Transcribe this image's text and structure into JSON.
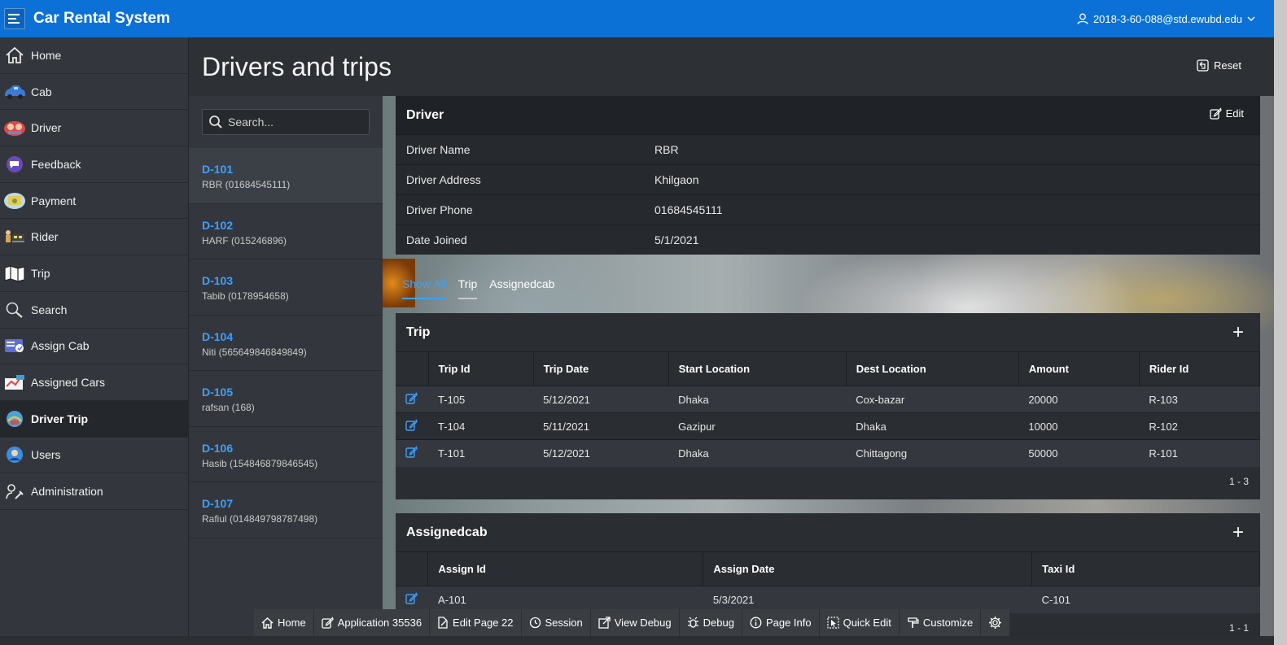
{
  "header": {
    "app_title": "Car Rental System",
    "user": "2018-3-60-088@std.ewubd.edu"
  },
  "sidebar": {
    "items": [
      {
        "label": "Home",
        "icon": "home-icon"
      },
      {
        "label": "Cab",
        "icon": "cab-icon"
      },
      {
        "label": "Driver",
        "icon": "driver-icon"
      },
      {
        "label": "Feedback",
        "icon": "feedback-icon"
      },
      {
        "label": "Payment",
        "icon": "payment-icon"
      },
      {
        "label": "Rider",
        "icon": "rider-icon"
      },
      {
        "label": "Trip",
        "icon": "trip-map-icon"
      },
      {
        "label": "Search",
        "icon": "search-icon"
      },
      {
        "label": "Assign Cab",
        "icon": "assign-cab-icon"
      },
      {
        "label": "Assigned Cars",
        "icon": "assigned-cars-icon"
      },
      {
        "label": "Driver Trip",
        "icon": "driver-trip-icon"
      },
      {
        "label": "Users",
        "icon": "users-icon"
      },
      {
        "label": "Administration",
        "icon": "administration-icon"
      }
    ],
    "active": "Driver Trip"
  },
  "page": {
    "title": "Drivers and trips",
    "reset_label": "Reset"
  },
  "search": {
    "placeholder": "Search..."
  },
  "drivers": [
    {
      "code": "D-101",
      "sub": "RBR (01684545111)"
    },
    {
      "code": "D-102",
      "sub": "HARF (015246896)"
    },
    {
      "code": "D-103",
      "sub": "Tabib (0178954658)"
    },
    {
      "code": "D-104",
      "sub": "Niti (565649846849849)"
    },
    {
      "code": "D-105",
      "sub": "rafsan (168)"
    },
    {
      "code": "D-106",
      "sub": "Hasib (154846879846545)"
    },
    {
      "code": "D-107",
      "sub": "Rafiul (014849798787498)"
    }
  ],
  "driver_card": {
    "title": "Driver",
    "edit_label": "Edit",
    "fields": [
      {
        "label": "Driver Name",
        "value": "RBR"
      },
      {
        "label": "Driver Address",
        "value": "Khilgaon"
      },
      {
        "label": "Driver Phone",
        "value": "01684545111"
      },
      {
        "label": "Date Joined",
        "value": "5/1/2021"
      }
    ]
  },
  "tabs": [
    "Show All",
    "Trip",
    "Assignedcab"
  ],
  "trip": {
    "title": "Trip",
    "columns": [
      "Trip Id",
      "Trip Date",
      "Start Location",
      "Dest Location",
      "Amount",
      "Rider Id"
    ],
    "rows": [
      [
        "T-105",
        "5/12/2021",
        "Dhaka",
        "Cox-bazar",
        "20000",
        "R-103"
      ],
      [
        "T-104",
        "5/11/2021",
        "Gazipur",
        "Dhaka",
        "10000",
        "R-102"
      ],
      [
        "T-101",
        "5/12/2021",
        "Dhaka",
        "Chittagong",
        "50000",
        "R-101"
      ]
    ],
    "pagination": "1 - 3"
  },
  "assignedcab": {
    "title": "Assignedcab",
    "columns": [
      "Assign Id",
      "Assign Date",
      "Taxi Id"
    ],
    "rows": [
      [
        "A-101",
        "5/3/2021",
        "C-101"
      ]
    ],
    "pagination": "1 - 1"
  },
  "devbar": [
    "Home",
    "Application 35536",
    "Edit Page 22",
    "Session",
    "View Debug",
    "Debug",
    "Page Info",
    "Quick Edit",
    "Customize"
  ],
  "colors": {
    "brand": "#0b71d7",
    "link": "#3fa0ff"
  }
}
